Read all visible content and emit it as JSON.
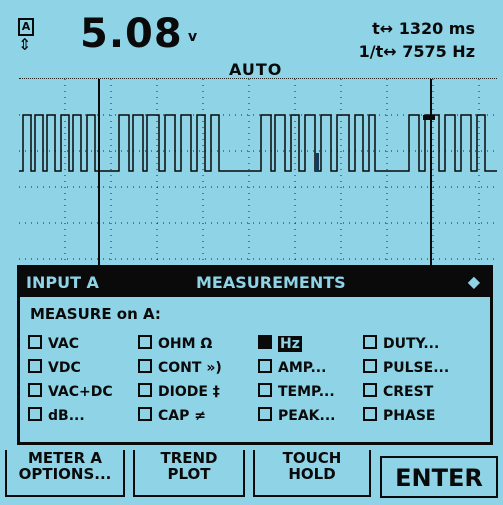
{
  "header": {
    "channel_label": "A",
    "reading_value": "5.08",
    "reading_unit": "v",
    "time_readout": "t↔ 1320 ms",
    "freq_readout": "1/t↔ 7575 Hz",
    "mode_label": "AUTO"
  },
  "panel": {
    "title_left": "INPUT A",
    "title_center": "MEASUREMENTS",
    "subtitle": "MEASURE on A:",
    "options": [
      [
        "VAC",
        "OHM Ω",
        "Hz",
        "DUTY..."
      ],
      [
        "VDC",
        "CONT »)",
        "AMP...",
        "PULSE..."
      ],
      [
        "VAC+DC",
        "DIODE ‡",
        "TEMP...",
        "CREST"
      ],
      [
        "dB...",
        "CAP ≠",
        "PEAK...",
        "PHASE"
      ]
    ],
    "selected": "Hz"
  },
  "softkeys": {
    "meter_line1": "METER A",
    "meter_line2": "OPTIONS...",
    "trend_line1": "TREND",
    "trend_line2": "PLOT",
    "touch_line1": "TOUCH",
    "touch_line2": "HOLD",
    "enter": "ENTER"
  },
  "colors": {
    "background": "#8fd3e6",
    "foreground": "#0a0a0a"
  }
}
